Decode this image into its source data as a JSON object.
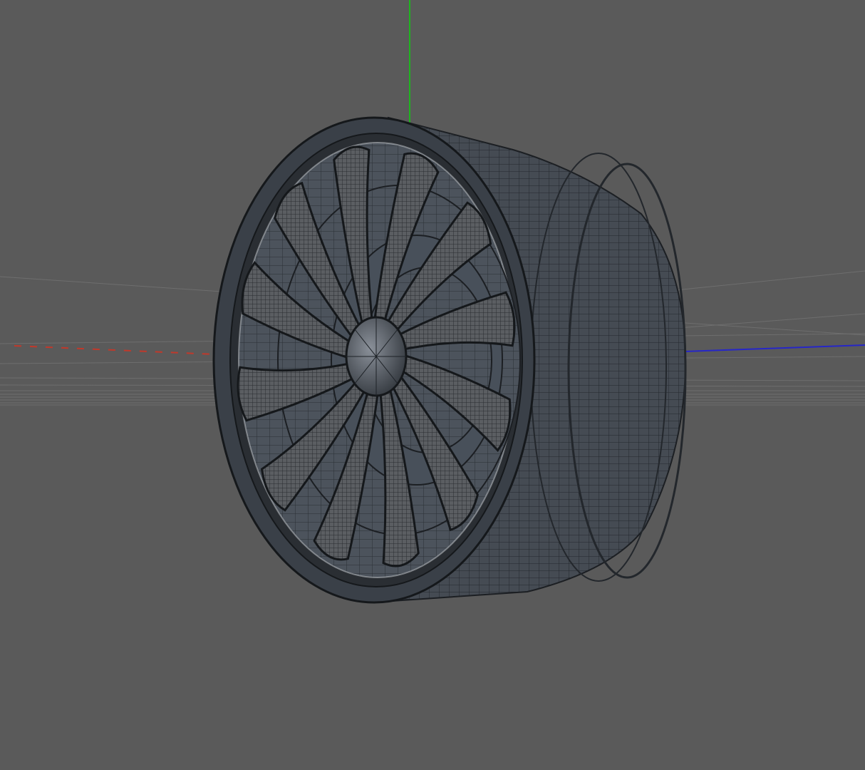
{
  "viewport": {
    "background": "#5a5a5a",
    "mode": "wireframe-on-shaded",
    "axes": {
      "x_color": "#c0392b",
      "y_color": "#1fb31f",
      "z_color": "#2626c8"
    },
    "grid": {
      "visible": true,
      "color": "#6e6e6e"
    }
  },
  "object": {
    "type": "wheel-rim",
    "spoke_count": 12,
    "mesh_color": "#3e444c",
    "wire_color": "#1c1f23",
    "icons": [
      "wheel-icon"
    ]
  }
}
